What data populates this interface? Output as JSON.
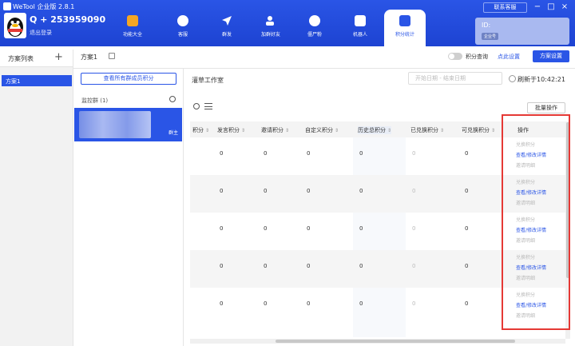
{
  "app": {
    "title": "WeTool 企业版 2.8.1",
    "support_label": "联系客服"
  },
  "account": {
    "name": "Q + 253959090",
    "logout": "退出登录",
    "id_label": "ID:",
    "badge": "企业号"
  },
  "nav": [
    {
      "label": "功能大全",
      "color": "#f5a623"
    },
    {
      "label": "客服",
      "color": "#ffffff"
    },
    {
      "label": "群发",
      "color": "#ffffff"
    },
    {
      "label": "加群好友",
      "color": "#ffffff"
    },
    {
      "label": "僵尸粉",
      "color": "#ffffff"
    },
    {
      "label": "机器人",
      "color": "#ffffff"
    },
    {
      "label": "积分统计",
      "color": "#2a55e6"
    }
  ],
  "sidebar": {
    "title": "方案列表",
    "items": [
      "方案1"
    ]
  },
  "plan": {
    "name": "方案1",
    "points_query": "积分查询",
    "click_set": "点此设置",
    "settings_btn": "方案设置"
  },
  "groups": {
    "view_all": "查看所有群成员积分",
    "monitor_label": "监控群 (1)",
    "owner_tag": "群主"
  },
  "main": {
    "workroom": "灌草工作室",
    "date_range": "开始日期  -  结束日期",
    "refresh": "刷新于10:42:21",
    "batch": "批量操作",
    "columns": [
      "积分",
      "发言积分",
      "邀请积分",
      "自定义积分",
      "历史总积分",
      "已兑换积分",
      "可兑换积分",
      "操作"
    ],
    "rows": [
      [
        "0",
        "0",
        "0",
        "0",
        "0",
        "0"
      ],
      [
        "0",
        "0",
        "0",
        "0",
        "0",
        "0"
      ],
      [
        "0",
        "0",
        "0",
        "0",
        "0",
        "0"
      ],
      [
        "0",
        "0",
        "0",
        "0",
        "0",
        "0"
      ],
      [
        "0",
        "0",
        "0",
        "0",
        "0",
        "0"
      ]
    ],
    "ops": {
      "exchange": "兑换积分",
      "view_edit": "查看/修改详情",
      "invite": "邀请明细"
    }
  }
}
